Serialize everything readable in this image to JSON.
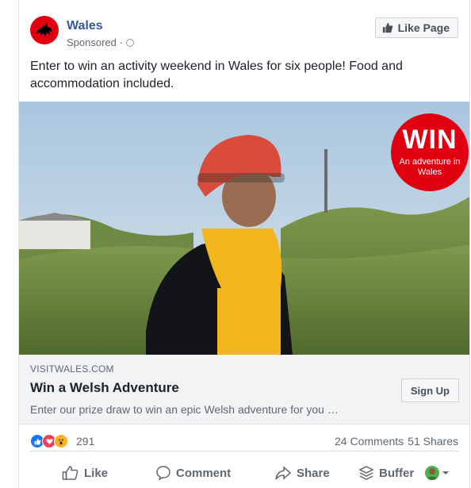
{
  "post": {
    "page_name": "Wales",
    "sponsored": "Sponsored ·",
    "text": "Enter to win an activity weekend in Wales for six people! Food and accommodation included.",
    "like_page_label": "Like Page"
  },
  "hero": {
    "badge_title": "WIN",
    "badge_subtitle": "An adventure in Wales"
  },
  "link": {
    "domain": "VISITWALES.COM",
    "title": "Win a Welsh Adventure",
    "description": "Enter our prize draw to win an epic Welsh adventure for you …",
    "cta_label": "Sign Up"
  },
  "engagement": {
    "reaction_count": "291",
    "comments": "24 Comments",
    "shares": "51 Shares"
  },
  "actions": {
    "like": "Like",
    "comment": "Comment",
    "share": "Share",
    "buffer": "Buffer"
  },
  "colors": {
    "brand_red": "#e1000f",
    "link_blue": "#365899",
    "like_blue": "#1877f2"
  },
  "icons": [
    "wales-dragon-icon",
    "globe-icon",
    "thumbs-up-icon",
    "like-reaction-icon",
    "love-reaction-icon",
    "wow-reaction-icon",
    "comment-icon",
    "share-icon",
    "buffer-icon",
    "chevron-down-icon"
  ]
}
